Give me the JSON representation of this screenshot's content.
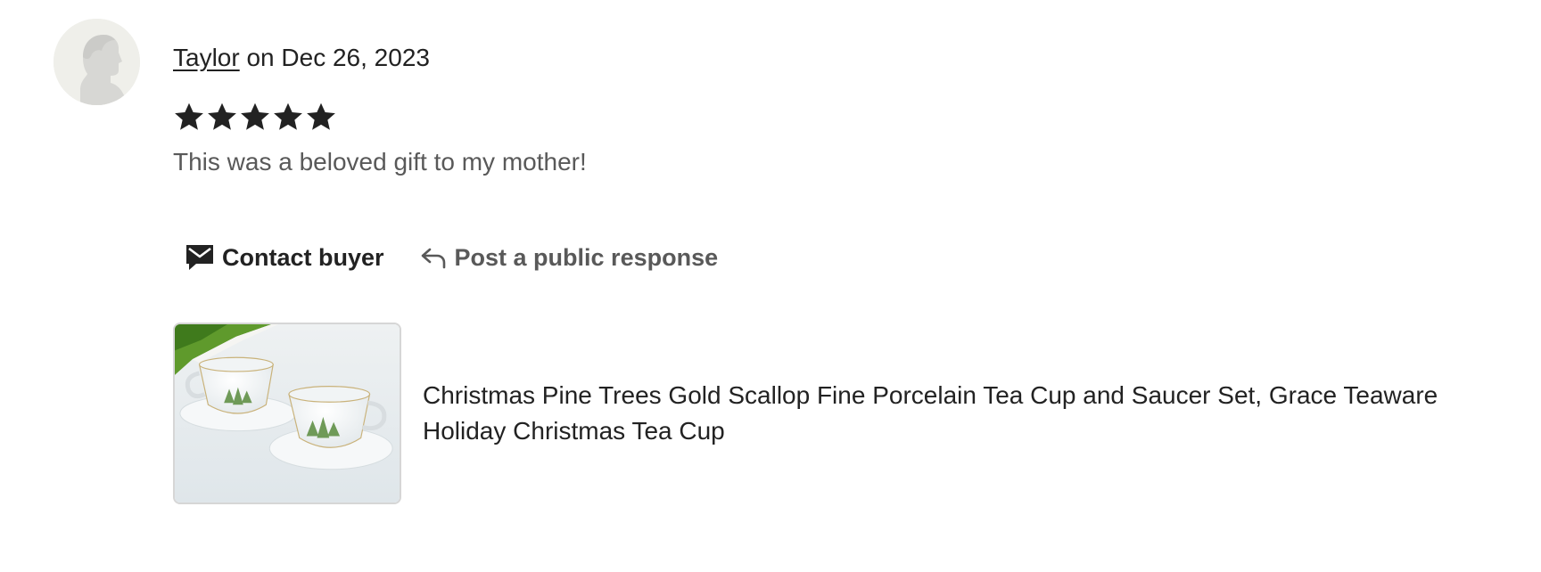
{
  "review": {
    "reviewer_name": "Taylor",
    "date_text": "on Dec 26, 2023",
    "rating": 5,
    "rating_max": 5,
    "text": "This was a beloved gift to my mother!"
  },
  "actions": {
    "contact_label": "Contact buyer",
    "respond_label": "Post a public response"
  },
  "listing": {
    "title": "Christmas Pine Trees Gold Scallop Fine Porcelain Tea Cup and Saucer Set, Grace Teaware Holiday Christmas Tea Cup"
  },
  "icons": {
    "avatar": "default-user-silhouette-icon",
    "star": "star-filled-icon",
    "contact": "envelope-message-icon",
    "respond": "reply-arrow-icon"
  },
  "colors": {
    "text_primary": "#222222",
    "text_secondary": "#595959",
    "avatar_bg": "#efefea",
    "thumb_border": "#d6d6d6"
  }
}
